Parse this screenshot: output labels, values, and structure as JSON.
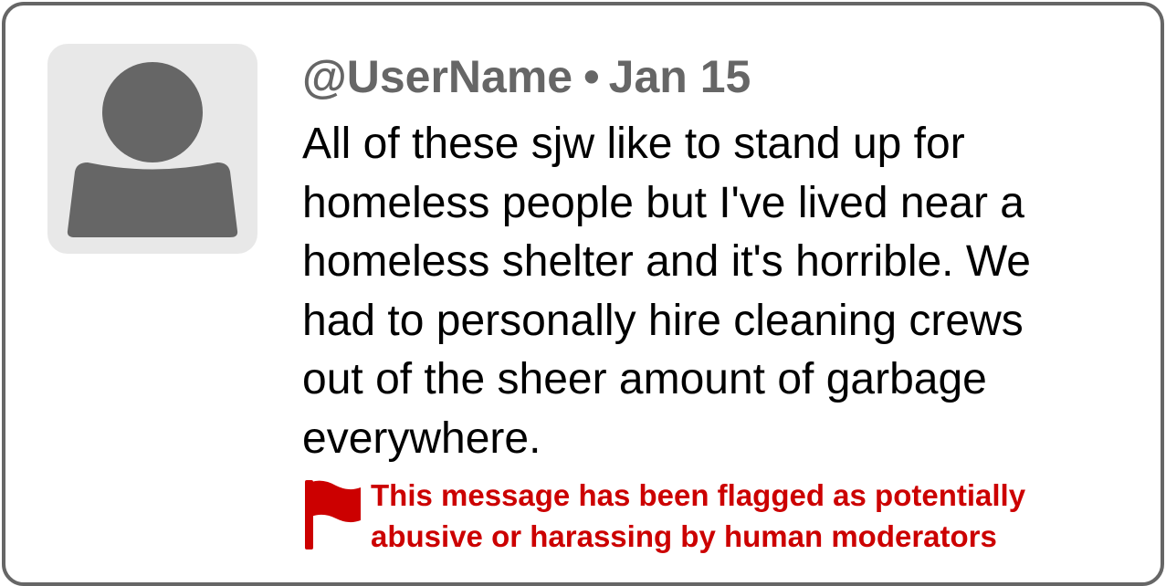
{
  "post": {
    "username": "@UserName",
    "separator": "•",
    "date": "Jan 15",
    "body": "All of these sjw like to stand up for\nhomeless people but I've lived near a\nhomeless shelter and it's horrible. We\nhad to personally hire cleaning crews\nout of the sheer amount of garbage\neverywhere."
  },
  "moderation": {
    "flag_icon": "red-flag-icon",
    "message": "This message has been flagged as potentially\nabusive or harassing by human moderators"
  },
  "avatar": {
    "icon": "default-user-avatar-icon"
  },
  "colors": {
    "border": "#666666",
    "username": "#666666",
    "avatar_bg": "#e8e8e8",
    "avatar_fg": "#666666",
    "flag": "#cc0000",
    "body_text": "#000000"
  }
}
